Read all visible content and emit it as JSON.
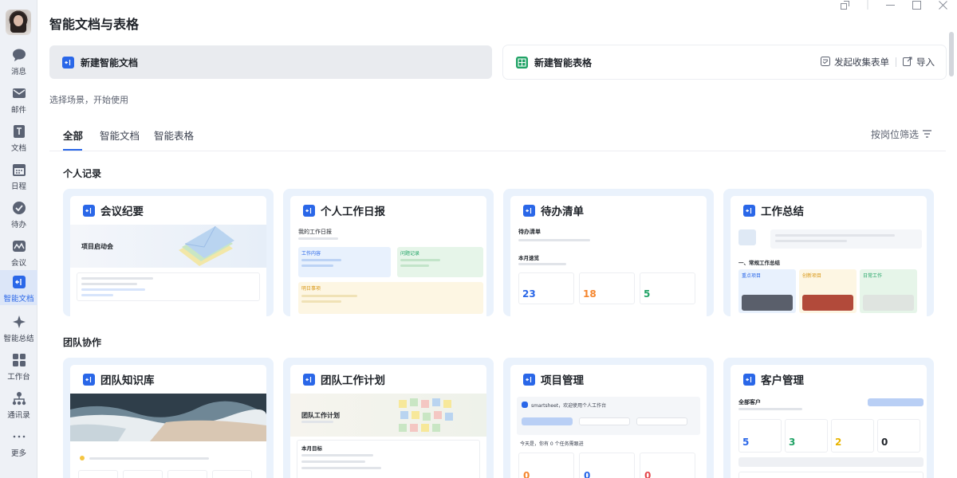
{
  "sidebar": {
    "items": [
      {
        "label": "消息",
        "icon": "chat-icon"
      },
      {
        "label": "邮件",
        "icon": "mail-icon"
      },
      {
        "label": "文档",
        "icon": "doc-icon"
      },
      {
        "label": "日程",
        "icon": "calendar-icon"
      },
      {
        "label": "待办",
        "icon": "check-circle-icon"
      },
      {
        "label": "会议",
        "icon": "meeting-icon"
      },
      {
        "label": "智能文档",
        "icon": "smart-doc-icon"
      },
      {
        "label": "智能总结",
        "icon": "sparkle-icon"
      },
      {
        "label": "工作台",
        "icon": "grid-icon"
      },
      {
        "label": "通讯录",
        "icon": "contacts-icon"
      },
      {
        "label": "更多",
        "icon": "more-icon"
      }
    ],
    "active_index": 6
  },
  "header": {
    "title": "智能文档与表格"
  },
  "create": {
    "doc_label": "新建智能文档",
    "sheet_label": "新建智能表格",
    "collect_form_label": "发起收集表单",
    "import_label": "导入"
  },
  "hint": "选择场景，开始使用",
  "tabs": [
    {
      "label": "全部",
      "active": true
    },
    {
      "label": "智能文档",
      "active": false
    },
    {
      "label": "智能表格",
      "active": false
    }
  ],
  "filter_label": "按岗位筛选",
  "sections": {
    "personal": "个人记录",
    "team": "团队协作"
  },
  "cards": {
    "meeting": {
      "name": "会议纪要",
      "preview_title": "项目启动会"
    },
    "daily": {
      "name": "个人工作日报",
      "preview_title": "我的工作日报",
      "col1": "工作内容",
      "col2": "问题记录",
      "col3": "明日事项"
    },
    "todo": {
      "name": "待办清单",
      "preview_title": "待办清单",
      "preview_sub": "本月速览",
      "stats": [
        "23",
        "18",
        "5"
      ]
    },
    "summary": {
      "name": "工作总结",
      "preview_section": "一、常规工作总结",
      "tags": [
        "重点项目",
        "创新项目",
        "日常工作"
      ]
    },
    "kb": {
      "name": "团队知识库"
    },
    "plan": {
      "name": "团队工作计划",
      "preview_title": "团队工作计划",
      "preview_sub": "本月目标"
    },
    "pm": {
      "name": "项目管理",
      "preview_head": "smartsheet，欢迎使用个人工作台",
      "preview_sub": "今天是，你有 0 个任务需跟进",
      "stats": [
        "0",
        "0",
        "0"
      ]
    },
    "crm": {
      "name": "客户管理",
      "preview_title": "全部客户",
      "stats": [
        "5",
        "3",
        "2",
        "0"
      ]
    }
  },
  "colors": {
    "accent": "#2a67e8",
    "sheet_green": "#21a366",
    "stat_blue": "#2a67e8",
    "stat_orange": "#f5862e",
    "stat_green": "#21a366",
    "stat_red": "#e5484d",
    "stat_yellow": "#e8b400"
  }
}
